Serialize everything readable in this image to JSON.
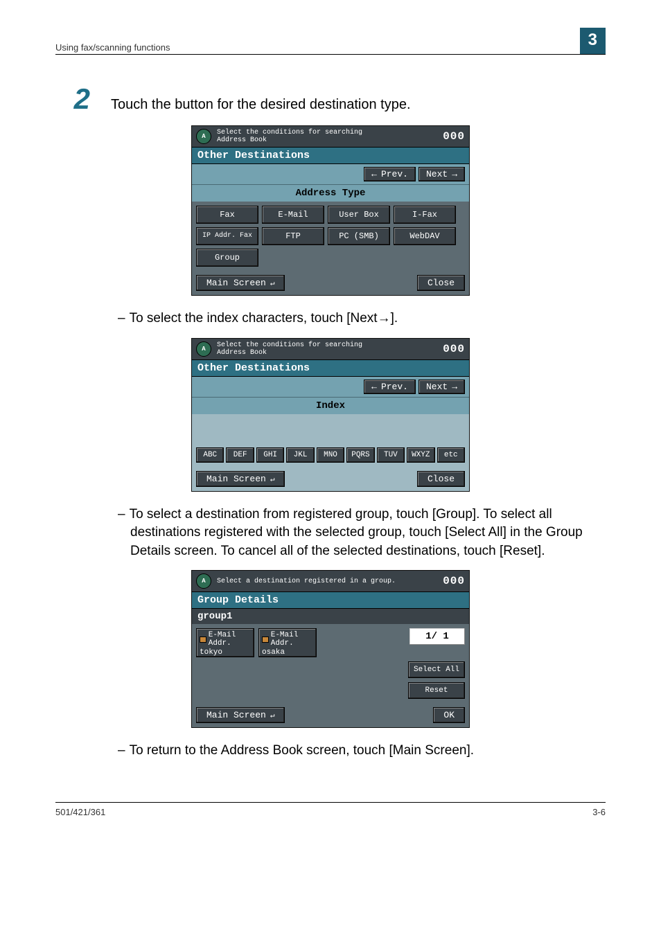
{
  "header": {
    "section": "Using fax/scanning functions",
    "chapter": "3"
  },
  "step": {
    "number": "2",
    "text": "Touch the button for the desired destination type."
  },
  "panel1": {
    "top_msg": "Select the conditions for searching\nAddress Book",
    "counter": "000",
    "title": "Other Destinations",
    "prev": "Prev.",
    "next": "Next",
    "section": "Address Type",
    "buttons": [
      "Fax",
      "E-Mail",
      "User Box",
      "I-Fax",
      "IP Addr. Fax",
      "FTP",
      "PC (SMB)",
      "WebDAV",
      "Group"
    ],
    "main": "Main Screen",
    "close": "Close"
  },
  "bullet1": "To select the index characters, touch [Next→].",
  "panel2": {
    "top_msg": "Select the conditions for searching\nAddress Book",
    "counter": "000",
    "title": "Other Destinations",
    "prev": "Prev.",
    "next": "Next",
    "section": "Index",
    "tabs": [
      "ABC",
      "DEF",
      "GHI",
      "JKL",
      "MNO",
      "PQRS",
      "TUV",
      "WXYZ",
      "etc"
    ],
    "main": "Main Screen",
    "close": "Close"
  },
  "bullet2": "To select a destination from registered group, touch [Group]. To select all destinations registered with the selected group, touch [Select All] in the Group Details screen. To cancel all of the selected destinations, touch [Reset].",
  "panel3": {
    "top_msg": "Select a destination registered in a group.",
    "counter": "000",
    "title": "Group Details",
    "subtitle": "group1",
    "items": [
      {
        "type": "E-Mail Addr.",
        "name": "tokyo"
      },
      {
        "type": "E-Mail Addr.",
        "name": "osaka"
      }
    ],
    "page": "1/ 1",
    "select_all": "Select All",
    "reset": "Reset",
    "main": "Main Screen",
    "ok": "OK"
  },
  "bullet3": "To return to the Address Book screen, touch [Main Screen].",
  "footer": {
    "left": "501/421/361",
    "right": "3-6"
  }
}
